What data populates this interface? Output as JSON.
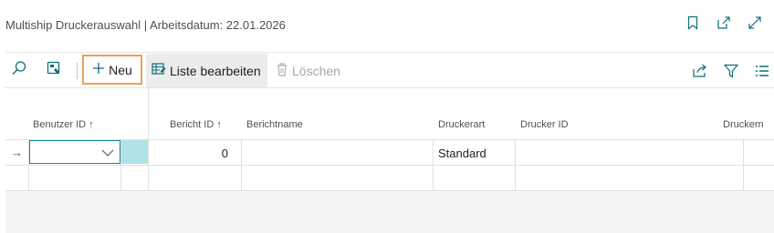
{
  "header": {
    "title": "Multiship Druckerauswahl | Arbeitsdatum: 22.01.2026"
  },
  "toolbar": {
    "new_label": "Neu",
    "edit_list_label": "Liste bearbeiten",
    "delete_label": "Löschen"
  },
  "table": {
    "columns": [
      "Benutzer ID ↑",
      "Bericht ID ↑",
      "Berichtname",
      "Druckerart",
      "Drucker ID",
      "Druckern"
    ],
    "rows": [
      {
        "user_id": "",
        "report_id": "0",
        "report_name": "",
        "printer_type": "Standard",
        "printer_id": "",
        "printer_name": ""
      }
    ]
  },
  "colors": {
    "accent": "#0f8796",
    "focus_outline": "#e8a15a",
    "selected_cell": "#b1e2e8"
  }
}
